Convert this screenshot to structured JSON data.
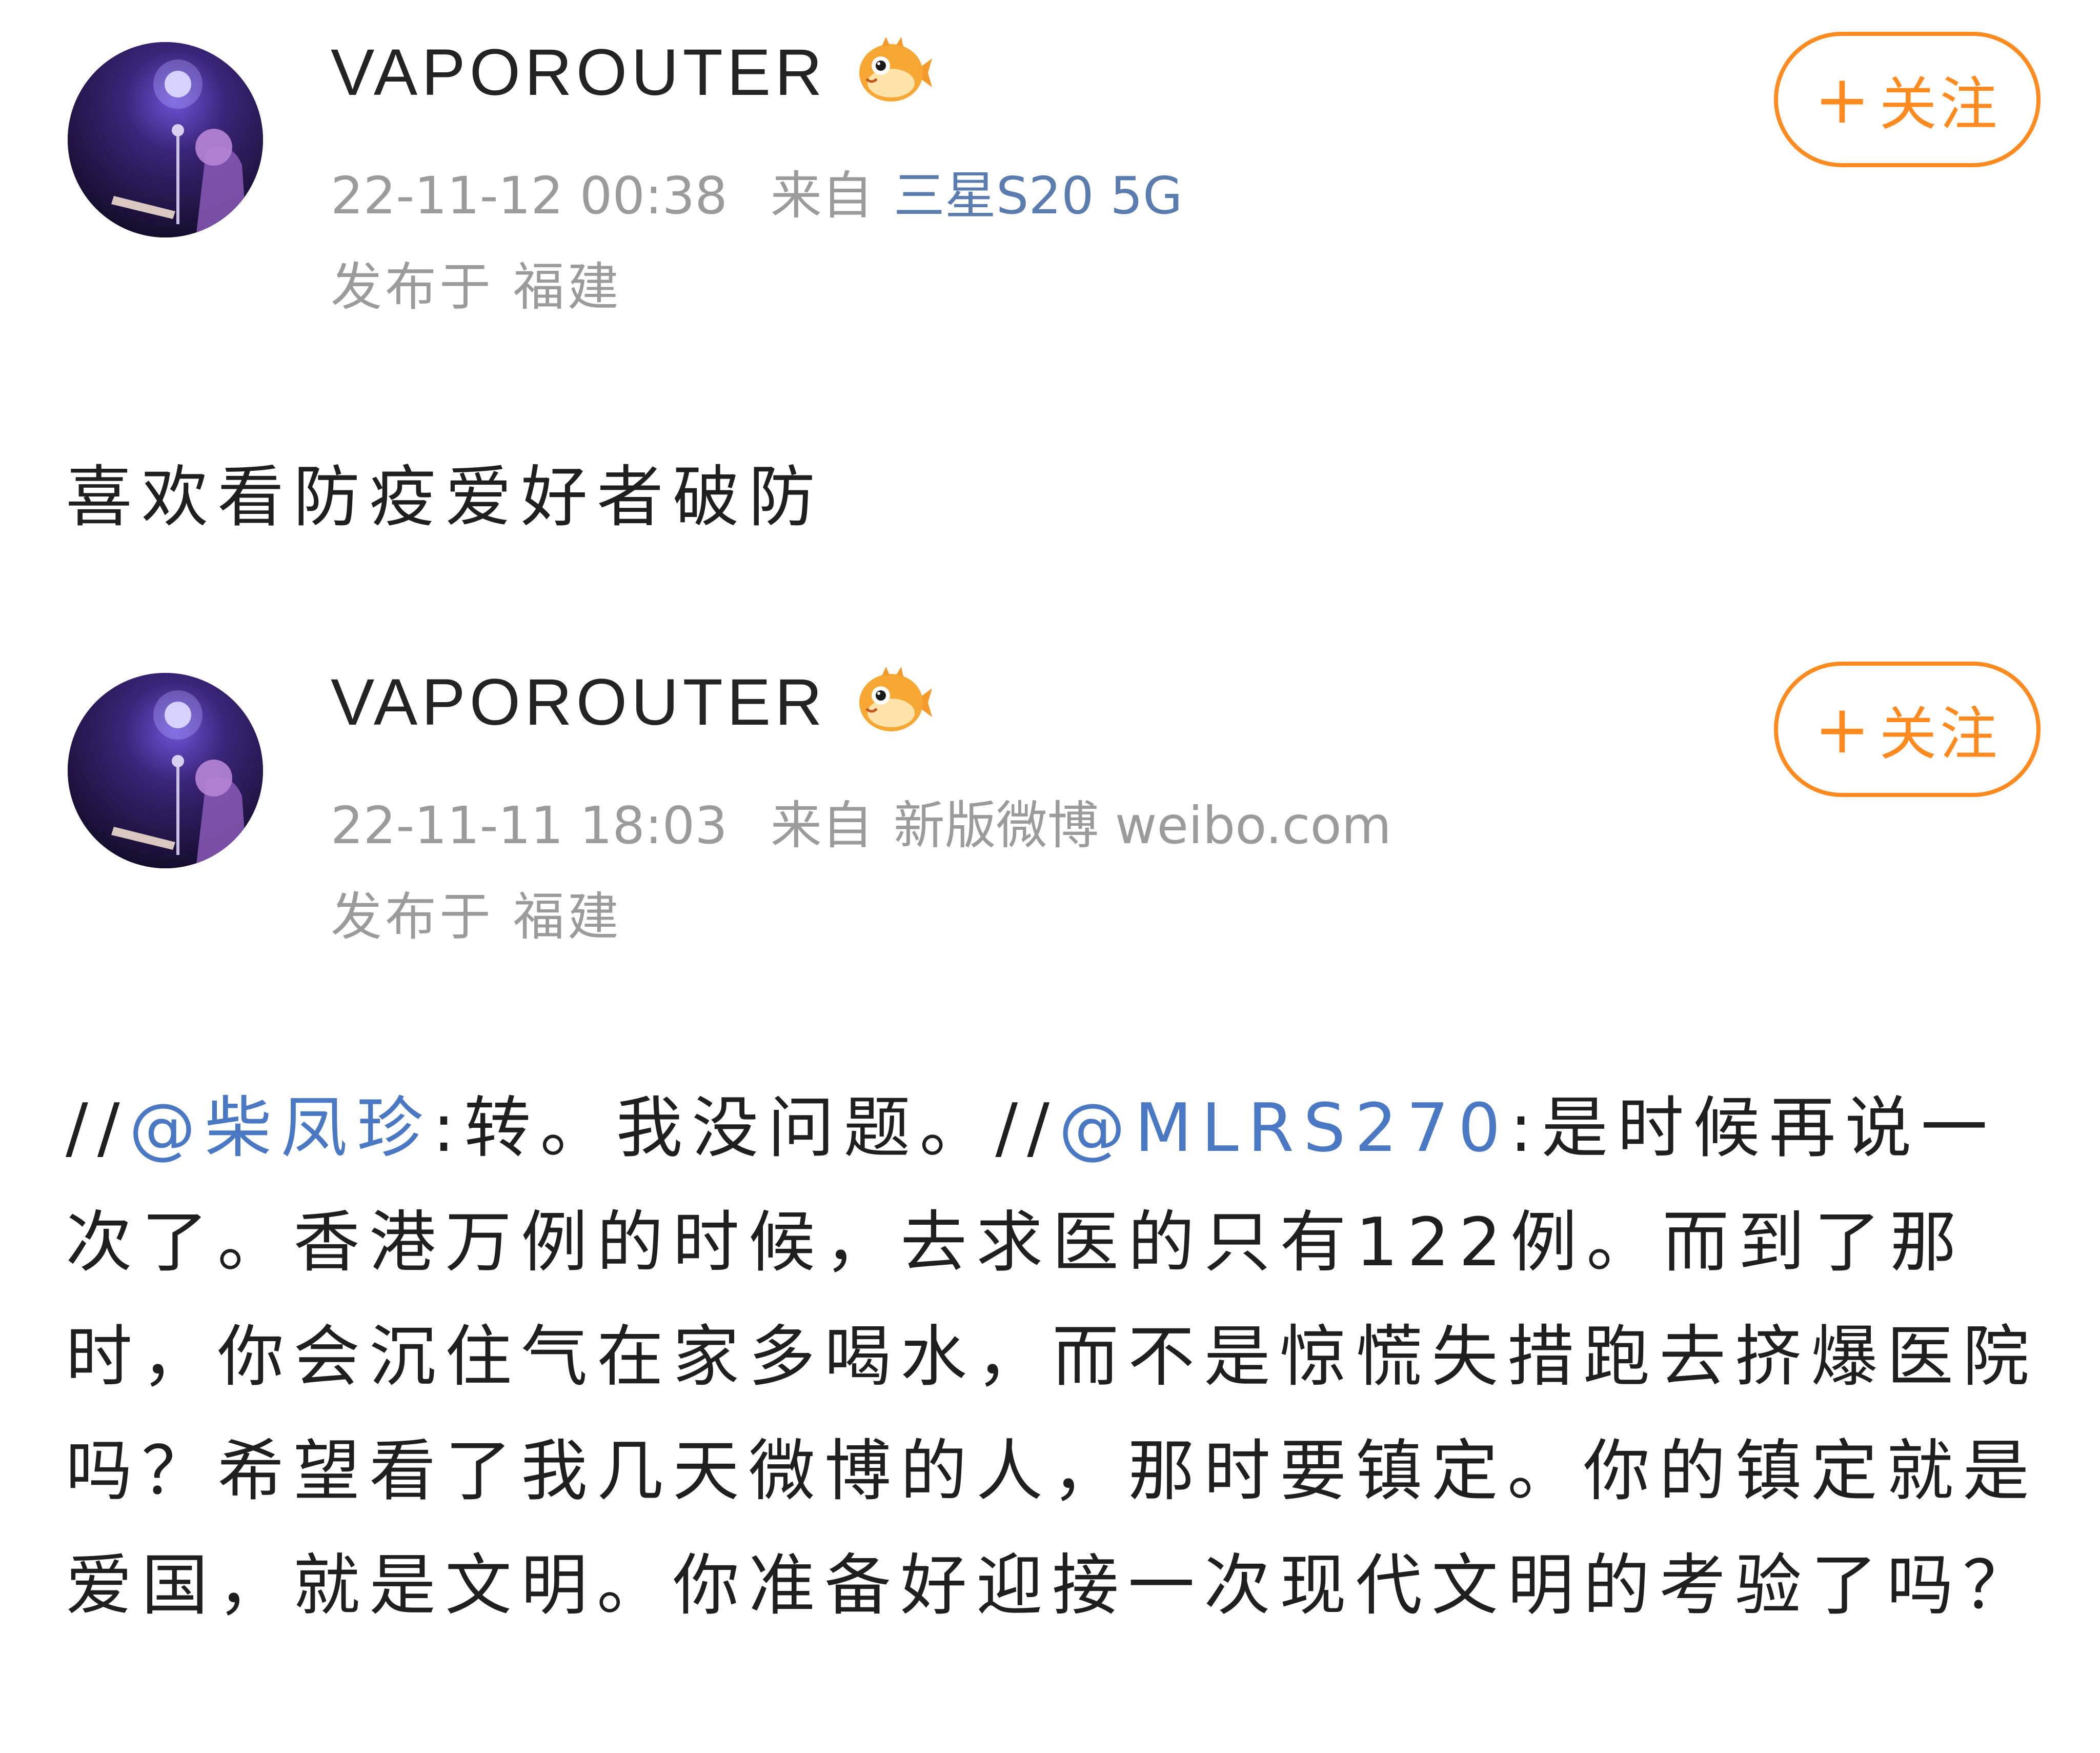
{
  "posts": [
    {
      "username": "VAPOROUTER",
      "badge_icon": "pufferfish-icon",
      "timestamp": "22-11-12 00:38",
      "from_label": "来自",
      "source": "三星S20 5G",
      "location": "发布于 福建",
      "follow_label": "关注",
      "follow_plus": "+",
      "content": {
        "text": "喜欢看防疫爱好者破防"
      }
    },
    {
      "username": "VAPOROUTER",
      "badge_icon": "pufferfish-icon",
      "timestamp": "22-11-11 18:03",
      "from_label": "来自",
      "source": "新版微博 weibo.com",
      "location": "发布于 福建",
      "follow_label": "关注",
      "follow_plus": "+",
      "content": {
        "prefix1": "//",
        "mention1": "@柴凤珍",
        "text1": ":转。我没问题。//",
        "mention2": "@MLRS270",
        "text2": ":是时候再说一次了。香港万例的时候，去求医的只有122例。而到了那时，你会沉住气在家多喝水，而不是惊慌失措跑去挤爆医院吗？希望看了我几天微博的人，那时要镇定。你的镇定就是爱国，就是文明。你准备好迎接一次现代文明的考验了吗？"
      }
    }
  ],
  "colors": {
    "accent_orange": "#ff8a1f",
    "link_blue": "#4a78c2",
    "meta_gray": "#9b9b9b"
  }
}
